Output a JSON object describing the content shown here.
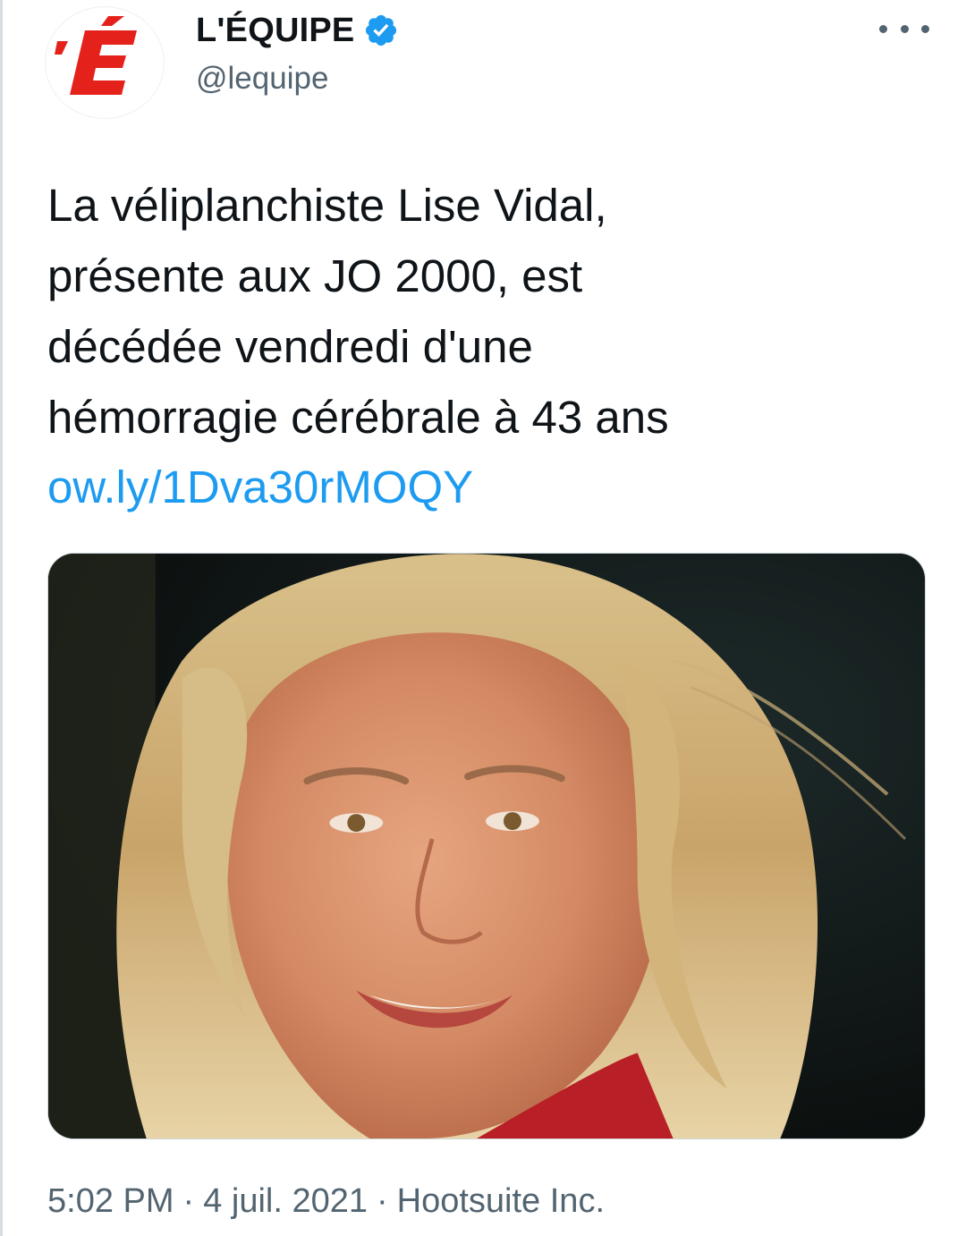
{
  "author": {
    "display_name": "L'ÉQUIPE",
    "handle": "@lequipe",
    "verified": true,
    "avatar_logo_text": "'E",
    "logo_color": "#e4221b"
  },
  "tweet": {
    "text": "La véliplanchiste Lise Vidal,\nprésente aux JO 2000, est\ndécédée vendredi d'une\nhémorragie cérébrale à 43 ans",
    "link": "ow.ly/1Dva30rMOQY"
  },
  "media": {
    "type": "photo"
  },
  "meta": {
    "time": "5:02 PM",
    "separator": "·",
    "date": "4 juil. 2021",
    "source": "Hootsuite Inc."
  },
  "icons": {
    "verified": "verified-badge-icon",
    "more": "more-options-icon"
  },
  "colors": {
    "link": "#1d9bf0",
    "secondary_text": "#536471",
    "verified": "#1d9bf0"
  }
}
